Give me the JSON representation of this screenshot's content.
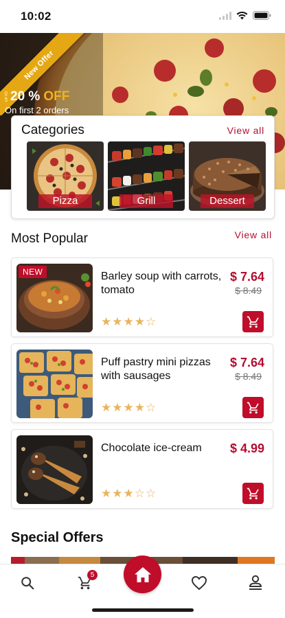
{
  "status_bar": {
    "time": "10:02"
  },
  "hero": {
    "ribbon_text": "New Offer",
    "upto_text": "UP TO",
    "discount_percent": "20 %",
    "discount_off": "OFF",
    "subtitle": "On first 2 orders"
  },
  "categories": {
    "title": "Categories",
    "view_all": "View all",
    "items": [
      {
        "label": "Pizza"
      },
      {
        "label": "Grill"
      },
      {
        "label": "Dessert"
      }
    ]
  },
  "most_popular": {
    "title": "Most Popular",
    "view_all": "View all",
    "items": [
      {
        "name": "Barley soup with carrots, tomato",
        "badge": "NEW",
        "price": "$ 7.64",
        "old_price": "$ 8.49",
        "rating": 4,
        "stars": "★★★★☆"
      },
      {
        "name": "Puff pastry mini pizzas with sausages",
        "price": "$ 7.64",
        "old_price": "$ 8.49",
        "rating": 4,
        "stars": "★★★★☆"
      },
      {
        "name": "Chocolate ice-cream",
        "price": "$ 4.99",
        "rating": 3,
        "stars": "★★★☆☆"
      }
    ]
  },
  "special_offers": {
    "title": "Special Offers"
  },
  "bottom_nav": {
    "cart_count": "5",
    "items": [
      "search-icon",
      "cart-icon",
      "home-icon",
      "heart-icon",
      "account-icon"
    ]
  },
  "colors": {
    "accent": "#c00d2a",
    "offer_yellow": "#e5a814",
    "star": "#e9b45c"
  }
}
